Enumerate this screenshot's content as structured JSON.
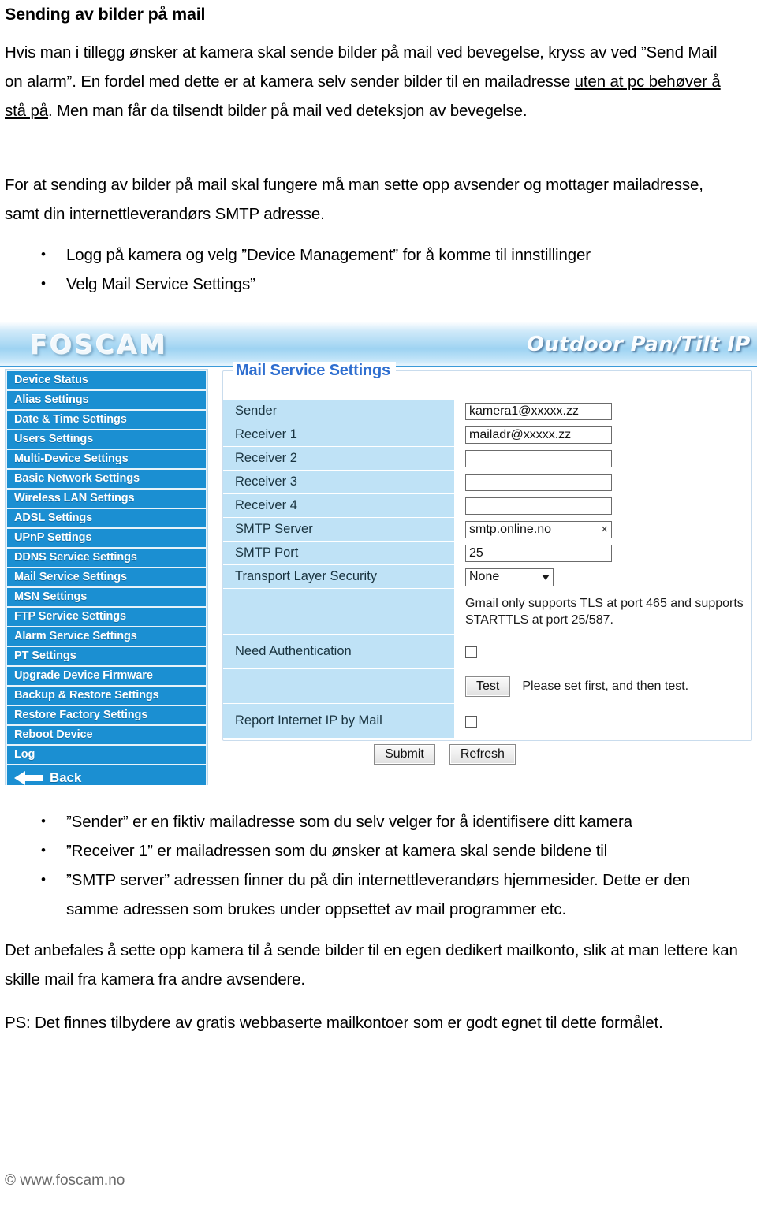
{
  "document": {
    "heading": "Sending av bilder på mail",
    "para1_a": "Hvis man i tillegg ønsker at kamera skal sende bilder på mail ved bevegelse, kryss av ved ”Send Mail on alarm”. En fordel med dette er at kamera selv sender bilder til en mailadresse ",
    "para1_u": "uten at pc behøver å stå på",
    "para1_b": ". Men man får da tilsendt bilder på mail ved deteksjon av bevegelse.",
    "para2": "For at sending av bilder på mail skal fungere må man sette opp avsender og mottager mailadresse, samt din internettleverandørs SMTP adresse.",
    "steps": [
      "Logg på kamera og velg ”Device Management” for å komme til innstillinger",
      "Velg Mail Service Settings”"
    ],
    "notes": [
      "”Sender” er en fiktiv mailadresse som du selv velger for å identifisere ditt kamera",
      "”Receiver 1” er mailadressen som du ønsker at kamera skal sende bildene til",
      "”SMTP server” adressen finner du på din internettleverandørs hjemmesider. Dette er den samme adressen som brukes under oppsettet av mail programmer etc."
    ],
    "para3": "Det anbefales å sette opp kamera til å sende bilder til en egen dedikert mailkonto, slik at man lettere kan skille mail fra kamera fra andre avsendere.",
    "para4": "PS: Det finnes tilbydere av gratis webbaserte mailkontoer som er godt egnet til dette formålet.",
    "footer": "© www.foscam.no"
  },
  "camera_ui": {
    "brand": "FOSCAM",
    "model_title": "Outdoor Pan/Tilt IP Cam",
    "sidebar": [
      "Device Status",
      "Alias Settings",
      "Date & Time Settings",
      "Users Settings",
      "Multi-Device Settings",
      "Basic Network Settings",
      "Wireless LAN Settings",
      "ADSL Settings",
      "UPnP Settings",
      "DDNS Service Settings",
      "Mail Service Settings",
      "MSN Settings",
      "FTP Service Settings",
      "Alarm Service Settings",
      "PT Settings",
      "Upgrade Device Firmware",
      "Backup & Restore Settings",
      "Restore Factory Settings",
      "Reboot Device",
      "Log"
    ],
    "back_label": "Back",
    "panel_title": "Mail Service Settings",
    "fields": {
      "sender_label": "Sender",
      "sender_value": "kamera1@xxxxx.zz",
      "receiver1_label": "Receiver 1",
      "receiver1_value": "mailadr@xxxxx.zz",
      "receiver2_label": "Receiver 2",
      "receiver2_value": "",
      "receiver3_label": "Receiver 3",
      "receiver3_value": "",
      "receiver4_label": "Receiver 4",
      "receiver4_value": "",
      "smtp_server_label": "SMTP Server",
      "smtp_server_value": "smtp.online.no",
      "smtp_server_clear": "×",
      "smtp_port_label": "SMTP Port",
      "smtp_port_value": "25",
      "tls_label": "Transport Layer Security",
      "tls_value": "None",
      "tls_hint": "Gmail only supports TLS at port 465 and supports STARTTLS at port 25/587.",
      "need_auth_label": "Need Authentication",
      "test_button": "Test",
      "test_note": "Please set first, and then test.",
      "report_ip_label": "Report Internet IP by Mail",
      "submit_button": "Submit",
      "refresh_button": "Refresh"
    },
    "colors": {
      "nav_blue": "#1b8fd2",
      "label_blue": "#bfe2f6",
      "title_blue": "#2f6fd0"
    }
  }
}
